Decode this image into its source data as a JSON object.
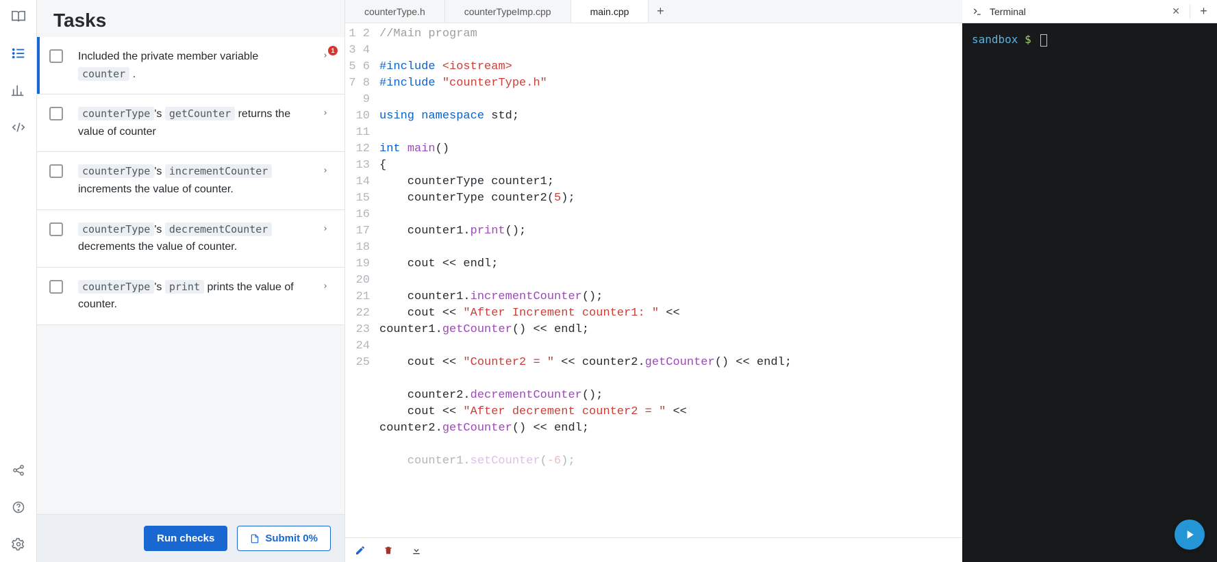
{
  "sidebar": {
    "icons": [
      "book",
      "tasks",
      "stats",
      "code",
      "share",
      "help",
      "settings"
    ]
  },
  "tasks": {
    "title": "Tasks",
    "items": [
      {
        "pre": "Included the private member variable ",
        "code": "counter",
        "post": " .",
        "badge": "1"
      },
      {
        "code": "counterType",
        "apos": "'s ",
        "code2": "getCounter",
        "post": " returns the value of counter"
      },
      {
        "code": "counterType",
        "apos": "'s ",
        "code2": "incrementCounter",
        "post": " increments the value of counter."
      },
      {
        "code": "counterType",
        "apos": "'s ",
        "code2": "decrementCounter",
        "post": " decrements the value of counter."
      },
      {
        "code": "counterType",
        "apos": "'s ",
        "code2": "print",
        "post": " prints the value of counter."
      }
    ],
    "run_label": "Run checks",
    "submit_label": "Submit 0%"
  },
  "editor": {
    "tabs": [
      "counterType.h",
      "counterTypeImp.cpp",
      "main.cpp"
    ],
    "active_tab": 2,
    "lines": [
      {
        "n": "1",
        "html": "<span class='tok-comment'>//Main program</span>"
      },
      {
        "n": "2",
        "html": ""
      },
      {
        "n": "3",
        "html": "<span class='tok-include'>#include</span> <span class='tok-string'>&lt;iostream&gt;</span>"
      },
      {
        "n": "4",
        "html": "<span class='tok-include'>#include</span> <span class='tok-string'>\"counterType.h\"</span>"
      },
      {
        "n": "5",
        "html": ""
      },
      {
        "n": "6",
        "html": "<span class='tok-keyword'>using</span> <span class='tok-keyword'>namespace</span> std;"
      },
      {
        "n": "7",
        "html": ""
      },
      {
        "n": "8",
        "html": "<span class='tok-type'>int</span> <span class='tok-func'>main</span>()"
      },
      {
        "n": "9",
        "html": "{"
      },
      {
        "n": "10",
        "html": "    counterType counter1;"
      },
      {
        "n": "11",
        "html": "    counterType counter2(<span class='tok-num'>5</span>);"
      },
      {
        "n": "12",
        "html": ""
      },
      {
        "n": "13",
        "html": "    counter1.<span class='tok-func'>print</span>();"
      },
      {
        "n": "14",
        "html": ""
      },
      {
        "n": "15",
        "html": "    cout &lt;&lt; endl;"
      },
      {
        "n": "16",
        "html": ""
      },
      {
        "n": "17",
        "html": "    counter1.<span class='tok-func'>incrementCounter</span>();"
      },
      {
        "n": "18",
        "html": "    cout &lt;&lt; <span class='tok-string'>\"After Increment counter1: \"</span> &lt;&lt; counter1.<span class='tok-func'>getCounter</span>() &lt;&lt; endl;",
        "wrap": true
      },
      {
        "n": "19",
        "html": ""
      },
      {
        "n": "20",
        "html": "    cout &lt;&lt; <span class='tok-string'>\"Counter2 = \"</span> &lt;&lt; counter2.<span class='tok-func'>getCounter</span>() &lt;&lt; endl;"
      },
      {
        "n": "21",
        "html": ""
      },
      {
        "n": "22",
        "html": "    counter2.<span class='tok-func'>decrementCounter</span>();"
      },
      {
        "n": "23",
        "html": "    cout &lt;&lt; <span class='tok-string'>\"After decrement counter2 = \"</span> &lt;&lt; counter2.<span class='tok-func'>getCounter</span>() &lt;&lt; endl;",
        "wrap": true
      },
      {
        "n": "24",
        "html": ""
      },
      {
        "n": "25",
        "html": "    counter1.<span class='tok-func'>setCounter</span>(<span class='tok-num'>-6</span>);",
        "fade": true
      }
    ]
  },
  "terminal": {
    "tab_label": "Terminal",
    "prompt": "sandbox",
    "dollar": "$"
  }
}
